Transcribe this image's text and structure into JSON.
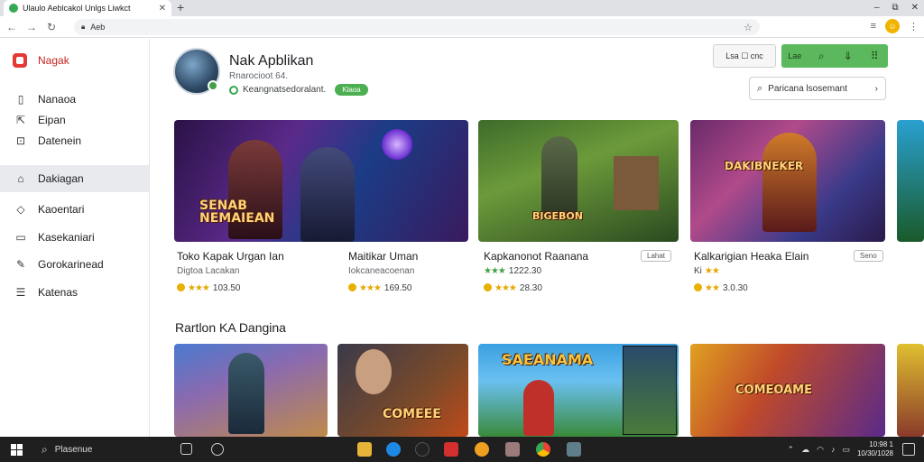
{
  "browser": {
    "tab_title": "Ulaulo Aeblcakol Unlgs Liwkct",
    "address": "Aeb",
    "new_tab_icon": "plus-icon",
    "window_controls": [
      "–",
      "⧉",
      "✕"
    ]
  },
  "sidebar": {
    "brand": "Nagak",
    "items": [
      {
        "label": "Nanaoa",
        "icon": "document-icon"
      },
      {
        "label": "Eipan",
        "icon": "export-icon"
      },
      {
        "label": "Datenein",
        "icon": "grid-icon"
      },
      {
        "label": "Dakiagan",
        "icon": "home-icon",
        "active": true
      },
      {
        "label": "Kaoentari",
        "icon": "tag-icon"
      },
      {
        "label": "Kasekaniari",
        "icon": "bookmark-icon"
      },
      {
        "label": "Gorokarinead",
        "icon": "pencil-icon"
      },
      {
        "label": "Katenas",
        "icon": "list-icon"
      }
    ]
  },
  "app": {
    "title": "Nak Apblikan",
    "subtitle": "Rnarocioot 64.",
    "developer": "Keangnatsedoralant.",
    "badge": "Klaoa"
  },
  "toolbar": {
    "group_text": "Lsa  ☐  cnc",
    "green_text": "Lae",
    "search_placeholder": "Paricana lsosemant"
  },
  "featured": [
    {
      "banner": "SENAB NEMAIEAN",
      "title": "Toko Kapak Urgan Ian",
      "subtitle": "Digtoa Lacakan",
      "rating_value": "103.50",
      "stars": "★★★"
    },
    {
      "banner": "",
      "title": "Maitikar Uman",
      "subtitle": "Iokcaneacoenan",
      "rating_value": "169.50",
      "stars": "★★★"
    },
    {
      "banner": "BIGEBON",
      "title": "Kapkanonot Raanana",
      "subtitle": "",
      "rating_value": "1222.30",
      "stars": "★★★",
      "button": "Lahat",
      "rating2": "28.30"
    },
    {
      "banner": "DAKIBNEKER",
      "title": "Kalkarigian Heaka Elain",
      "subtitle": "",
      "rating_value": "3.0.30",
      "stars": "★★",
      "button": "Seno",
      "prefix": "Ki"
    }
  ],
  "section_title": "Rartlon KA Dangina",
  "section_cards": [
    {
      "banner": ""
    },
    {
      "banner": "COMEEE"
    },
    {
      "banner": "SAEANAMA"
    },
    {
      "banner": "COMEOAME"
    }
  ],
  "taskbar": {
    "search_text": "Plasenue",
    "time": "10:98 1",
    "date": "10/30/1028"
  }
}
